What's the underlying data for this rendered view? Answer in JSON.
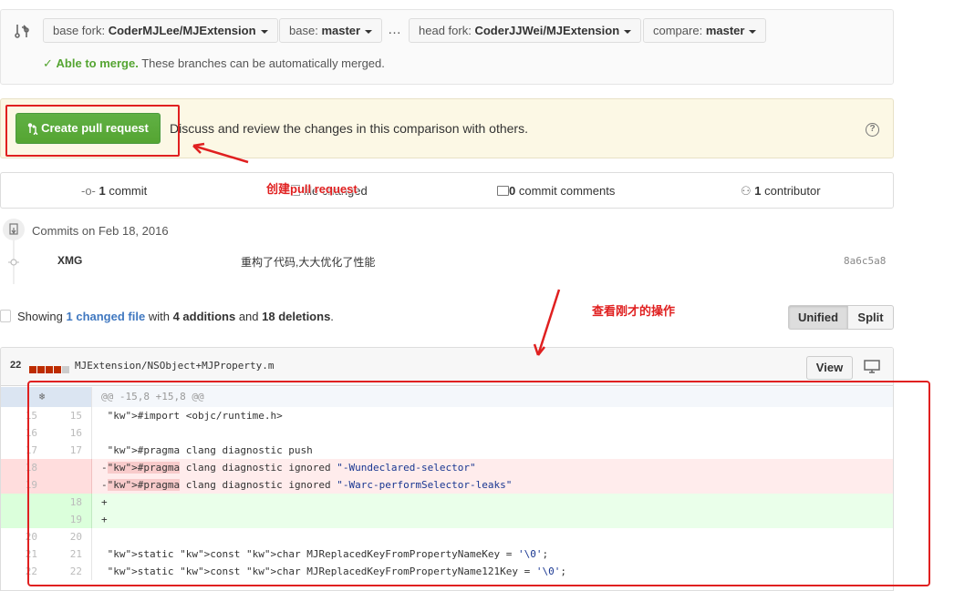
{
  "range_editor": {
    "base_fork_label": "base fork:",
    "base_fork_value": "CoderMJLee/MJExtension",
    "base_label": "base:",
    "base_value": "master",
    "ellipsis": "…",
    "head_fork_label": "head fork:",
    "head_fork_value": "CoderJJWei/MJExtension",
    "compare_label": "compare:",
    "compare_value": "master",
    "merge_status": "Able to merge.",
    "merge_detail": "These branches can be automatically merged."
  },
  "create_pr": {
    "button_label": "Create pull request",
    "description": "Discuss and review the changes in this comparison with others.",
    "help_icon": "?"
  },
  "summary": {
    "commits_count": "1",
    "commits_label": "commit",
    "files_label": "file changed",
    "comments_count": "0",
    "comments_label": "commit comments",
    "contributors_count": "1",
    "contributors_label": "contributor"
  },
  "commits": {
    "heading": "Commits on Feb 18, 2016",
    "items": [
      {
        "author": "XMG",
        "message": "重构了代码,大大优化了性能",
        "sha": "8a6c5a8"
      }
    ]
  },
  "toc": {
    "showing": "Showing",
    "changed_link": "1 changed file",
    "with": "with",
    "additions": "4 additions",
    "and": "and",
    "deletions": "18 deletions",
    "period": ".",
    "unified_label": "Unified",
    "split_label": "Split"
  },
  "file": {
    "stat": "22",
    "name": "MJExtension/NSObject+MJProperty.m",
    "view_label": "View",
    "hunk_header": "@@ -15,8 +15,8 @@",
    "lines": [
      {
        "type": "ctx",
        "old": "15",
        "new": "15",
        "text": " #import <objc/runtime.h>"
      },
      {
        "type": "ctx",
        "old": "16",
        "new": "16",
        "text": " "
      },
      {
        "type": "ctx",
        "old": "17",
        "new": "17",
        "text": " #pragma clang diagnostic push"
      },
      {
        "type": "del",
        "old": "18",
        "new": "",
        "text": "-#pragma clang diagnostic ignored \"-Wundeclared-selector\""
      },
      {
        "type": "del",
        "old": "19",
        "new": "",
        "text": "-#pragma clang diagnostic ignored \"-Warc-performSelector-leaks\""
      },
      {
        "type": "add",
        "old": "",
        "new": "18",
        "text": "+"
      },
      {
        "type": "add",
        "old": "",
        "new": "19",
        "text": "+"
      },
      {
        "type": "ctx",
        "old": "20",
        "new": "20",
        "text": " "
      },
      {
        "type": "ctx",
        "old": "21",
        "new": "21",
        "text": " static const char MJReplacedKeyFromPropertyNameKey = '\\0';"
      },
      {
        "type": "ctx",
        "old": "22",
        "new": "22",
        "text": " static const char MJReplacedKeyFromPropertyName121Key = '\\0';"
      }
    ]
  },
  "annotations": {
    "create_label": "创建pull request",
    "view_label": "查看刚才的操作"
  },
  "colors": {
    "green": "#55a532",
    "link": "#4078c0",
    "annotation_red": "#e02020",
    "warning_bg": "#fcf8e5",
    "deletion_bg": "#ffecec",
    "addition_bg": "#eaffea"
  },
  "icons": {
    "compare": "git-compare-icon",
    "check": "check-icon",
    "pull_request": "git-pull-request-icon",
    "commit": "git-commit-icon",
    "file_diff": "file-diff-icon",
    "comment": "comment-icon",
    "contributor": "organization-icon",
    "expand": "unfold-icon",
    "desktop": "device-desktop-icon"
  }
}
